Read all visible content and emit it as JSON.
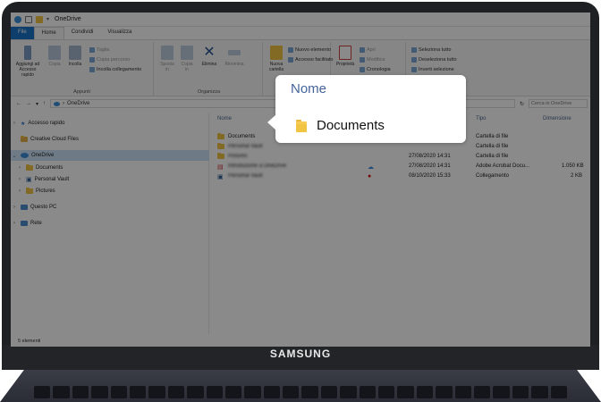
{
  "window": {
    "title": "OneDrive"
  },
  "ribbon_tabs": [
    "File",
    "Home",
    "Condividi",
    "Visualizza"
  ],
  "ribbon": {
    "clipboard": {
      "pin_label": "Aggiungi ad Accesso rapido",
      "copy_label": "Copia",
      "paste_label": "Incolla",
      "cut_label": "Taglia",
      "copy_path_label": "Copia percorso",
      "paste_shortcut_label": "Incolla collegamento",
      "group_label": "Appunti"
    },
    "organize": {
      "move_label": "Sposta in",
      "copy_to_label": "Copia in",
      "delete_label": "Elimina",
      "rename_label": "Rinomina",
      "group_label": "Organizza"
    },
    "new": {
      "new_folder_label": "Nuova cartella",
      "new_item_label": "Nuovo elemento",
      "easy_access_label": "Accesso facilitato"
    },
    "open": {
      "properties_label": "Proprietà",
      "open_label": "Apri",
      "edit_label": "Modifica",
      "history_label": "Cronologia"
    },
    "select": {
      "select_all_label": "Seleziona tutto",
      "select_none_label": "Deseleziona tutto",
      "invert_label": "Inverti selezione"
    }
  },
  "address": {
    "path": "OneDrive",
    "search_placeholder": "Cerca in OneDrive"
  },
  "nav": {
    "items": [
      {
        "label": "Accesso rapido"
      },
      {
        "label": "Creative Cloud Files"
      },
      {
        "label": "OneDrive"
      },
      {
        "label": "Documents"
      },
      {
        "label": "Personal Vault"
      },
      {
        "label": "Pictures"
      },
      {
        "label": "Questo PC"
      },
      {
        "label": "Rete"
      }
    ]
  },
  "columns": {
    "name": "Nome",
    "type": "Tipo",
    "size": "Dimensione"
  },
  "files": [
    {
      "name": "Documents",
      "date": "",
      "type": "Cartella di file",
      "size": ""
    },
    {
      "name": "Personal Vault",
      "date": "",
      "type": "Cartella di file",
      "size": ""
    },
    {
      "name": "Pictures",
      "date": "27/08/2020 14:31",
      "type": "Cartella di file",
      "size": ""
    },
    {
      "name": "Introduzione a OneDrive",
      "date": "27/08/2020 14:31",
      "type": "Adobe Acrobat Docu...",
      "size": "1.050 KB"
    },
    {
      "name": "Personal Vault",
      "date": "08/10/2020 15:33",
      "type": "Collegamento",
      "size": "2 KB"
    }
  ],
  "status": {
    "count": "5 elementi"
  },
  "callout": {
    "header": "Nome",
    "item": "Documents"
  },
  "device": {
    "brand": "SAMSUNG"
  },
  "colors": {
    "accent": "#1a73c8",
    "folder": "#f2c443",
    "callout_header": "#44649a",
    "selection": "#cce4f7"
  }
}
